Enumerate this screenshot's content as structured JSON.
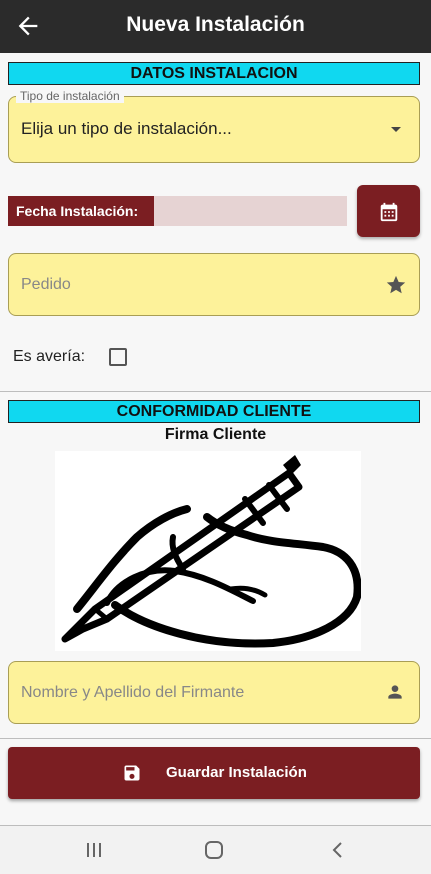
{
  "app_bar": {
    "title": "Nueva Instalación"
  },
  "sections": {
    "datos": "DATOS INSTALACION",
    "conformidad": "CONFORMIDAD CLIENTE"
  },
  "tipo_instalacion": {
    "label": "Tipo de instalación",
    "value": "Elija un tipo de instalación..."
  },
  "fecha": {
    "label": "Fecha Instalación:",
    "value": ""
  },
  "pedido": {
    "placeholder": "Pedido"
  },
  "averia": {
    "label": "Es avería:",
    "checked": false
  },
  "firma": {
    "title": "Firma Cliente"
  },
  "firmante": {
    "placeholder": "Nombre y Apellido del Firmante"
  },
  "save_button": {
    "label": "Guardar Instalación"
  },
  "icons": {
    "back": "arrow-left-icon",
    "calendar": "calendar-icon",
    "star": "star-icon",
    "person": "person-icon",
    "save": "floppy-disk-icon",
    "nav_recents": "recents-icon",
    "nav_home": "home-icon",
    "nav_back": "chevron-left-icon"
  },
  "colors": {
    "app_bar": "#2b2b2b",
    "section_header": "#10d8f0",
    "field_bg": "#fdf29a",
    "accent": "#7b1e22"
  }
}
